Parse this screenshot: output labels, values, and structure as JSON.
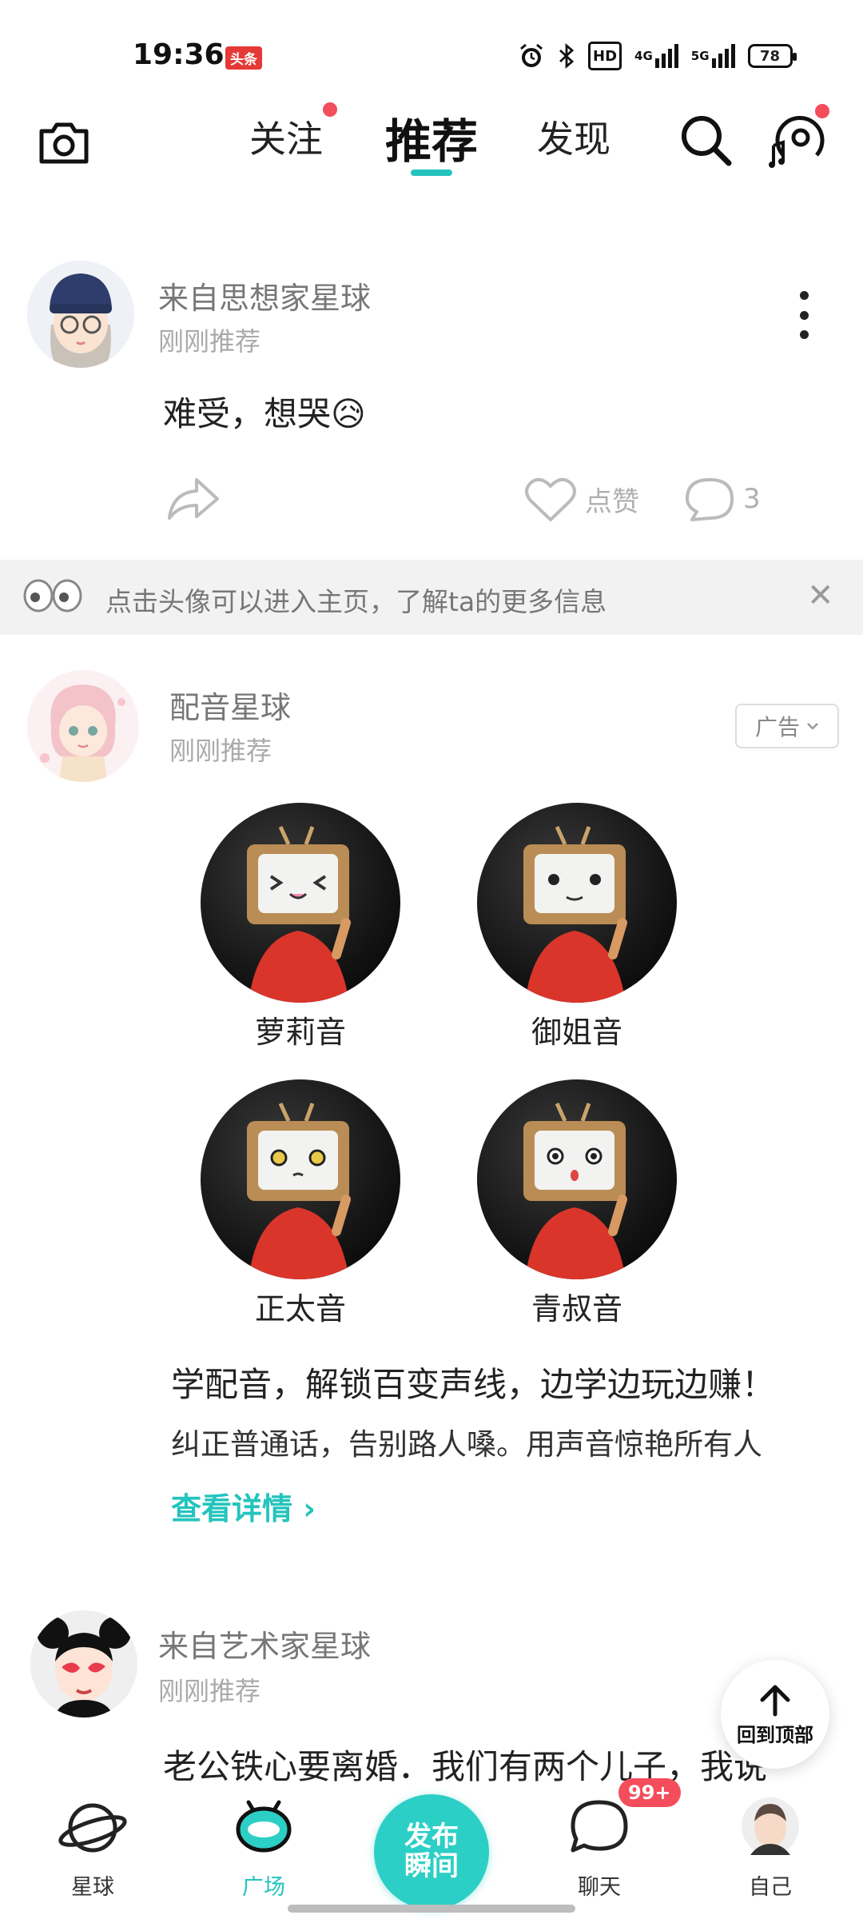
{
  "status_bar": {
    "time": "19:36",
    "badge": "头条",
    "network_4g": "4G",
    "network_5g": "5G",
    "hd": "HD",
    "battery": "78"
  },
  "top_nav": {
    "tabs": [
      {
        "label": "关注",
        "active": false,
        "has_dot": true
      },
      {
        "label": "推荐",
        "active": true,
        "has_dot": false
      },
      {
        "label": "发现",
        "active": false,
        "has_dot": false
      }
    ],
    "accent_color": "#24c4bd"
  },
  "post1": {
    "name": "来自思想家星球",
    "sub": "刚刚推荐",
    "text": "难受，想哭😥",
    "like_label": "点赞",
    "comment_count": "3"
  },
  "tip": {
    "text": "点击头像可以进入主页，了解ta的更多信息"
  },
  "ad": {
    "name": "配音星球",
    "sub": "刚刚推荐",
    "tag": "广告",
    "voices": [
      "萝莉音",
      "御姐音",
      "正太音",
      "青叔音"
    ],
    "title": "学配音，解锁百变声线，边学边玩边赚！",
    "desc": "纠正普通话，告别路人嗓。用声音惊艳所有人",
    "link": "查看详情 ›"
  },
  "post2": {
    "name": "来自艺术家星球",
    "sub": "刚刚推荐",
    "text": "老公铁心要离婚．我们有两个儿子，我说"
  },
  "back_top": {
    "label": "回到顶部"
  },
  "bottom_nav": {
    "items": [
      {
        "label": "星球",
        "active": false
      },
      {
        "label": "广场",
        "active": true
      },
      {
        "label": "聊天",
        "active": false
      },
      {
        "label": "自己",
        "active": false
      }
    ],
    "publish_line1": "发布",
    "publish_line2": "瞬间",
    "chat_badge": "99+"
  }
}
